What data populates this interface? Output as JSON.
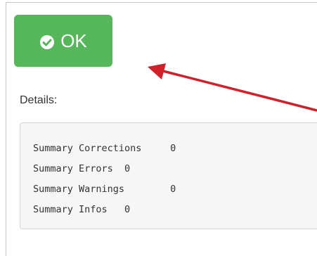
{
  "button": {
    "label": "OK",
    "icon": "check-circle-icon",
    "background": "#56b65a"
  },
  "details": {
    "label": "Details:",
    "lines": [
      "Summary Corrections     0",
      "Summary Errors  0",
      "Summary Warnings        0",
      "Summary Infos   0"
    ]
  },
  "annotation": {
    "arrow_color": "#d0202a"
  }
}
